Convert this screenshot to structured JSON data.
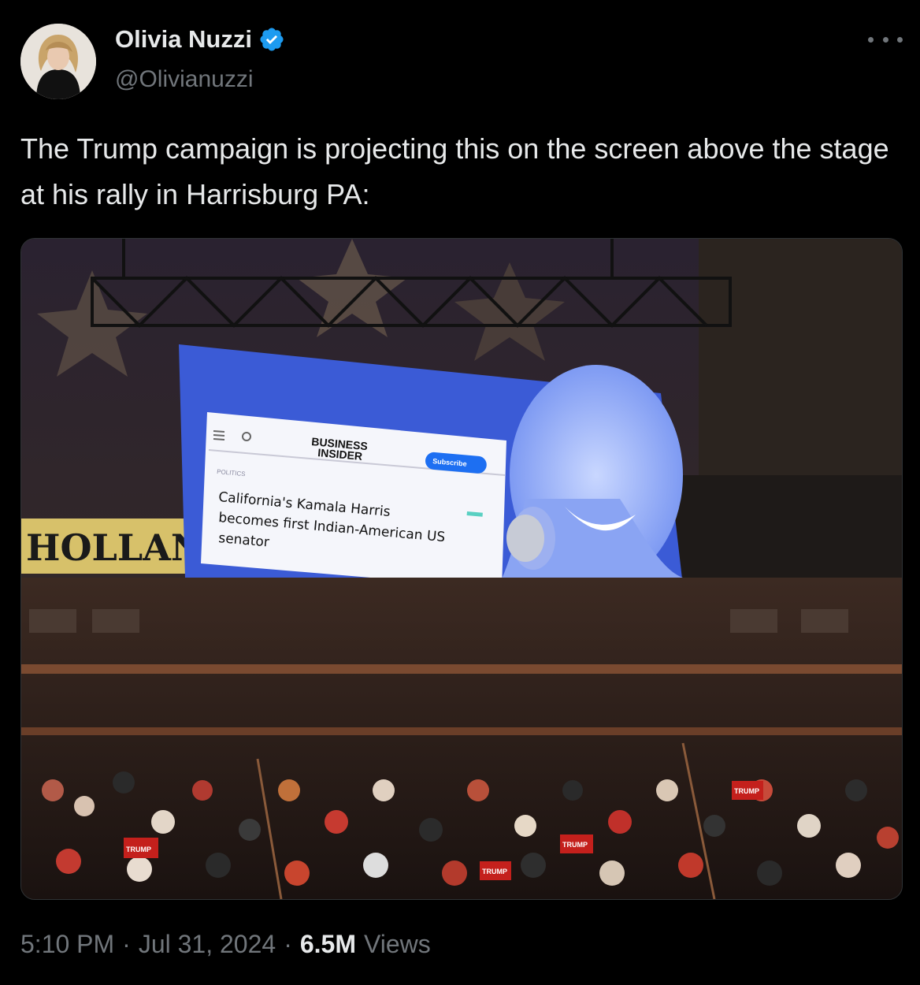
{
  "author": {
    "name": "Olivia Nuzzi",
    "handle": "@Olivianuzzi",
    "verified": true,
    "avatar_icon": "profile-photo"
  },
  "tweet": {
    "text": "The Trump campaign is projecting this on the screen above the stage at his rally in Harrisburg PA:"
  },
  "media": {
    "screen_article": {
      "brand_line1": "BUSINESS",
      "brand_line2": "INSIDER",
      "subscribe_label": "Subscribe",
      "section": "POLITICS",
      "headline_line1": "California's Kamala Harris",
      "headline_line2": "becomes first Indian-American US",
      "headline_line3": "senator"
    },
    "arena_banner": "HOLLAN",
    "signs": [
      "TRUMP",
      "TRUMP",
      "TRUMP",
      "TRUMP"
    ]
  },
  "meta": {
    "time": "5:10 PM",
    "separator": "·",
    "date": "Jul 31, 2024",
    "views_count": "6.5M",
    "views_label": "Views"
  },
  "colors": {
    "background": "#000000",
    "text_primary": "#e7e9ea",
    "text_secondary": "#71767b",
    "verified_blue": "#1d9bf0",
    "screen_blue": "#3b5bd6"
  }
}
